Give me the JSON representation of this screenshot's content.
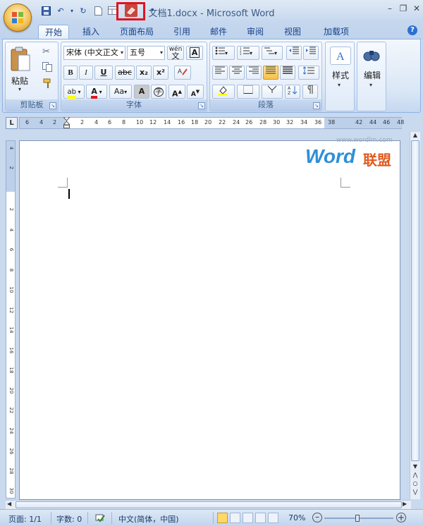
{
  "window": {
    "title": "文档1.docx - Microsoft Word"
  },
  "quick_access": [
    "save-icon",
    "undo-icon",
    "redo-icon",
    "new-document-icon",
    "print-preview-icon",
    "eraser-icon",
    "customize-dropdown-icon"
  ],
  "highlight_color": "#e0141e",
  "tabs": [
    "开始",
    "插入",
    "页面布局",
    "引用",
    "邮件",
    "审阅",
    "视图",
    "加载项"
  ],
  "ribbon": {
    "clipboard": {
      "label": "剪贴板",
      "paste": "粘贴"
    },
    "font": {
      "label": "字体",
      "font_name": "宋体 (中文正文",
      "font_size": "五号",
      "wen_label": "wén",
      "bold": "B",
      "italic": "I",
      "underline": "U",
      "strike": "abc",
      "sub": "x₂",
      "sup": "x²",
      "aa_label": "Aa",
      "a_label": "A",
      "zi_label": "字"
    },
    "paragraph": {
      "label": "段落"
    },
    "styles": {
      "label": "样式"
    },
    "editing": {
      "label": "编辑"
    }
  },
  "ruler": {
    "h_ticks": [
      "6",
      "4",
      "2",
      "2",
      "4",
      "6",
      "8",
      "10",
      "12",
      "14",
      "16",
      "18",
      "20",
      "22",
      "24",
      "26",
      "28",
      "30",
      "32",
      "34",
      "36",
      "38",
      "42",
      "44",
      "46",
      "48"
    ],
    "v_ticks": [
      "4",
      "2",
      "2",
      "4",
      "6",
      "8",
      "10",
      "12",
      "14",
      "16",
      "18",
      "20",
      "22",
      "24",
      "26",
      "28",
      "30"
    ]
  },
  "watermark": {
    "brand": "Word",
    "suffix": "联盟",
    "url": "www.wordlm.com"
  },
  "status": {
    "page": "页面: 1/1",
    "words": "字数: 0",
    "language": "中文(简体，中国)",
    "zoom": "70%"
  }
}
